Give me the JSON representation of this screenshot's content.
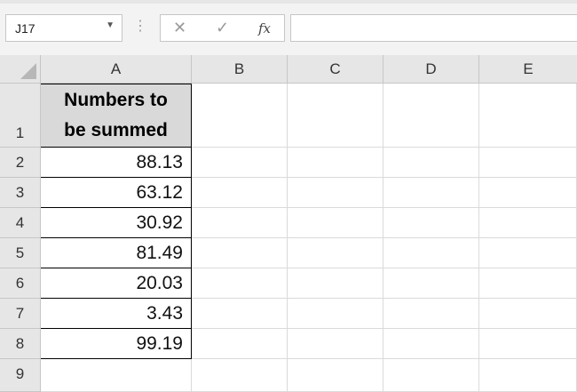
{
  "name_box": {
    "value": "J17",
    "dropdown_icon": "triangle-down"
  },
  "formula_bar": {
    "separator_icon": "vertical-dots",
    "cancel_icon": "cross",
    "enter_icon": "check",
    "function_icon": "fx",
    "cancel_glyph": "✕",
    "enter_glyph": "✓",
    "function_label": "fx",
    "content": ""
  },
  "columns": [
    "A",
    "B",
    "C",
    "D",
    "E"
  ],
  "rows": [
    "1",
    "2",
    "3",
    "4",
    "5",
    "6",
    "7",
    "8",
    "9"
  ],
  "cells": {
    "A1_line1": "Numbers to",
    "A1_line2": "be summed",
    "A2": "88.13",
    "A3": "63.12",
    "A4": "30.92",
    "A5": "81.49",
    "A6": "20.03",
    "A7": "3.43",
    "A8": "99.19",
    "A9": ""
  },
  "colors": {
    "header_fill": "#d9d9d9",
    "sheet_header_bg": "#e6e6e6",
    "grid": "#dadada",
    "border": "#000000"
  }
}
